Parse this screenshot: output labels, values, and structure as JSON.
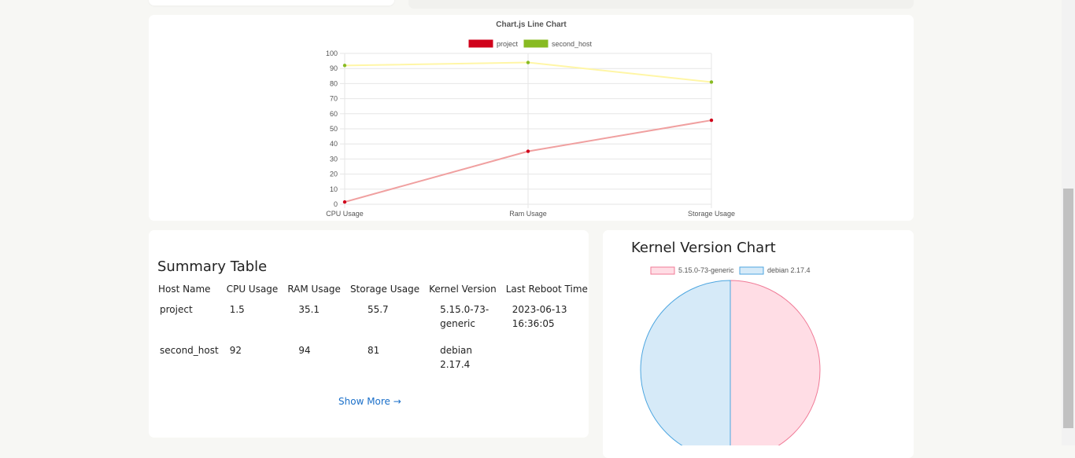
{
  "line_chart": {
    "title": "Chart.js Line Chart",
    "colors": {
      "project_line": "#f0a0a0",
      "project_point": "#d0021b",
      "second_line": "#fff6a6",
      "second_point": "#88bb22",
      "grid": "#e6e6e6",
      "tick": "#555555"
    },
    "chart_data": {
      "type": "line",
      "title": "Chart.js Line Chart",
      "categories": [
        "CPU Usage",
        "Ram Usage",
        "Storage Usage"
      ],
      "series": [
        {
          "name": "project",
          "values": [
            1.5,
            35.1,
            55.7
          ],
          "legend_color": "#d0021b"
        },
        {
          "name": "second_host",
          "values": [
            92,
            94,
            81
          ],
          "legend_color": "#88bb22"
        }
      ],
      "ylim": [
        0,
        100
      ],
      "yticks": [
        0,
        10,
        20,
        30,
        40,
        50,
        60,
        70,
        80,
        90,
        100
      ],
      "legend": "top",
      "grid": true
    }
  },
  "summary": {
    "title": "Summary Table",
    "columns": [
      "Host Name",
      "CPU Usage",
      "RAM Usage",
      "Storage Usage",
      "Kernel Version",
      "Last Reboot Time"
    ],
    "rows": [
      [
        "project",
        "1.5",
        "35.1",
        "55.7",
        "5.15.0-73-generic",
        "2023-06-13 16:36:05"
      ],
      [
        "second_host",
        "92",
        "94",
        "81",
        "debian 2.17.4",
        ""
      ]
    ],
    "show_more": "Show More →"
  },
  "pie": {
    "title": "Kernel Version Chart",
    "chart_data": {
      "type": "pie",
      "labels": [
        "5.15.0-73-generic",
        "debian 2.17.4"
      ],
      "values": [
        1,
        1
      ],
      "colors": [
        {
          "fill": "#ffdde5",
          "stroke": "#f07b97"
        },
        {
          "fill": "#d6eaf8",
          "stroke": "#4da6e0"
        }
      ],
      "legend": "top"
    }
  }
}
